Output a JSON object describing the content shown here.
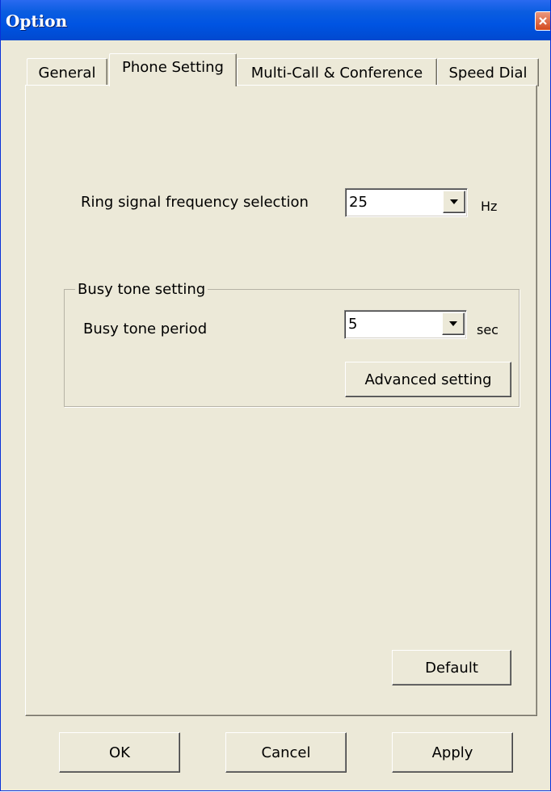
{
  "window": {
    "title": "Option"
  },
  "tabs": [
    {
      "label": "General",
      "active": false
    },
    {
      "label": "Phone Setting",
      "active": true
    },
    {
      "label": "Multi-Call & Conference",
      "active": false
    },
    {
      "label": "Speed Dial",
      "active": false
    }
  ],
  "phone_setting": {
    "ring_label": "Ring signal frequency selection",
    "ring_value": "25",
    "ring_unit": "Hz",
    "busy_group_label": "Busy tone setting",
    "busy_period_label": "Busy tone period",
    "busy_period_value": "5",
    "busy_period_unit": "sec",
    "advanced_button": "Advanced setting",
    "default_button": "Default"
  },
  "footer": {
    "ok": "OK",
    "cancel": "Cancel",
    "apply": "Apply"
  },
  "colors": {
    "titlebar": "#0054e3",
    "face": "#ece9d8",
    "close": "#d4481d"
  }
}
